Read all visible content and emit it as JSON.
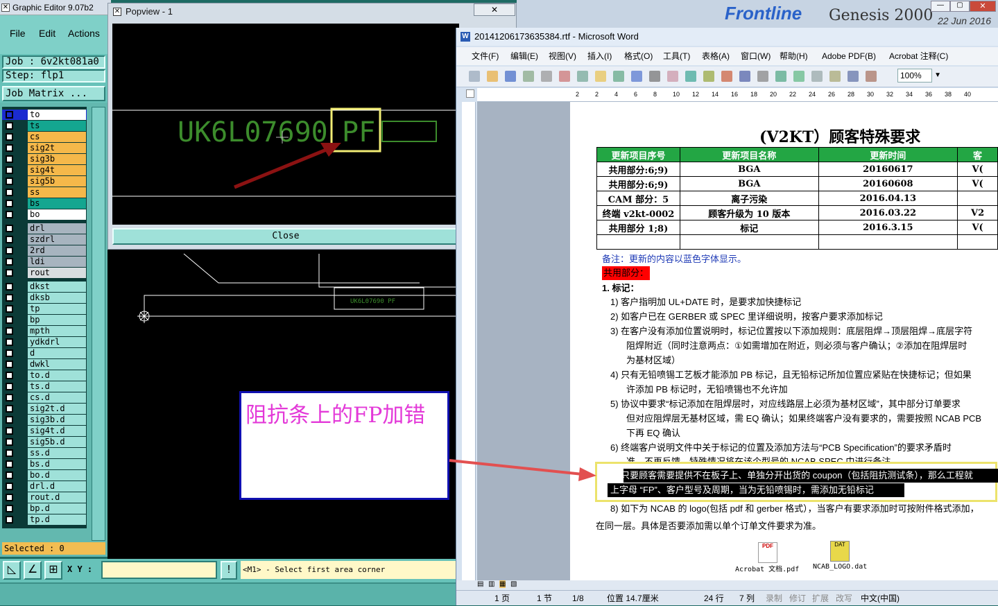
{
  "graphic_editor": {
    "title": "Graphic Editor 9.07b2",
    "menu": [
      "File",
      "Edit",
      "Actions"
    ],
    "job": "Job : 6v2kt081a0",
    "step": "Step: flp1",
    "job_matrix": "Job Matrix ...",
    "layers": [
      {
        "name": "to",
        "color": "#ffffff"
      },
      {
        "name": "ts",
        "color": "#14a690"
      },
      {
        "name": "cs",
        "color": "#f5b84a"
      },
      {
        "name": "sig2t",
        "color": "#f5b84a"
      },
      {
        "name": "sig3b",
        "color": "#f5b84a"
      },
      {
        "name": "sig4t",
        "color": "#f5b84a"
      },
      {
        "name": "sig5b",
        "color": "#f5b84a"
      },
      {
        "name": "ss",
        "color": "#f5b84a"
      },
      {
        "name": "bs",
        "color": "#14a690"
      },
      {
        "name": "bo",
        "color": "#ffffff"
      },
      {
        "name": "drl",
        "color": "#a7b4bf"
      },
      {
        "name": "szdrl",
        "color": "#a7b4bf"
      },
      {
        "name": "2rd",
        "color": "#a7b4bf"
      },
      {
        "name": "ldi",
        "color": "#a7b4bf"
      },
      {
        "name": "rout",
        "color": "#d8dde0"
      },
      {
        "name": "dkst",
        "color": "#9fe1d9"
      },
      {
        "name": "dksb",
        "color": "#9fe1d9"
      },
      {
        "name": "tp",
        "color": "#9fe1d9"
      },
      {
        "name": "bp",
        "color": "#9fe1d9"
      },
      {
        "name": "mpth",
        "color": "#9fe1d9"
      },
      {
        "name": "ydkdrl",
        "color": "#9fe1d9"
      },
      {
        "name": "d",
        "color": "#9fe1d9"
      },
      {
        "name": "dwkl",
        "color": "#9fe1d9"
      },
      {
        "name": "to.d",
        "color": "#9fe1d9"
      },
      {
        "name": "ts.d",
        "color": "#9fe1d9"
      },
      {
        "name": "cs.d",
        "color": "#9fe1d9"
      },
      {
        "name": "sig2t.d",
        "color": "#9fe1d9"
      },
      {
        "name": "sig3b.d",
        "color": "#9fe1d9"
      },
      {
        "name": "sig4t.d",
        "color": "#9fe1d9"
      },
      {
        "name": "sig5b.d",
        "color": "#9fe1d9"
      },
      {
        "name": "ss.d",
        "color": "#9fe1d9"
      },
      {
        "name": "bs.d",
        "color": "#9fe1d9"
      },
      {
        "name": "bo.d",
        "color": "#9fe1d9"
      },
      {
        "name": "drl.d",
        "color": "#9fe1d9"
      },
      {
        "name": "rout.d",
        "color": "#9fe1d9"
      },
      {
        "name": "bp.d",
        "color": "#9fe1d9"
      },
      {
        "name": "tp.d",
        "color": "#9fe1d9"
      }
    ],
    "selected": "Selected : 0",
    "xy_label": "X Y :",
    "hint": "<M1> - Select first area corner",
    "canvas_text": "UK6L07690  PF"
  },
  "popview": {
    "title": "Popview - 1",
    "canvas_text": "UK6L07690",
    "highlight_text": "PF",
    "close_label": "Close"
  },
  "annotation": {
    "text": "阻抗条上的FP加错"
  },
  "background_app": {
    "title": "Genesis 2000",
    "date": "22 Jun 2016",
    "brand": "Frontline"
  },
  "word": {
    "title": "20141206173635384.rtf - Microsoft Word",
    "menu": [
      "文件(F)",
      "编辑(E)",
      "视图(V)",
      "插入(I)",
      "格式(O)",
      "工具(T)",
      "表格(A)",
      "窗口(W)",
      "帮助(H)",
      "Adobe PDF(B)",
      "Acrobat 注释(C)"
    ],
    "zoom": "100%",
    "ruler_ticks": [
      "2",
      "2",
      "4",
      "6",
      "8",
      "10",
      "12",
      "14",
      "16",
      "18",
      "20",
      "22",
      "24",
      "26",
      "28",
      "30",
      "32",
      "34",
      "36",
      "38",
      "40"
    ],
    "doc_title": "(V2KT）顾客特殊要求",
    "table": {
      "headers": [
        "更新项目序号",
        "更新项目名称",
        "更新时间",
        "客"
      ],
      "rows": [
        [
          "共用部分:6;9)",
          "BGA",
          "20160617",
          "V("
        ],
        [
          "共用部分:6;9)",
          "BGA",
          "20160608",
          "V("
        ],
        [
          "CAM 部分：5",
          "离子污染",
          "2016.04.13",
          ""
        ],
        [
          "终端 v2kt-0002",
          "顾客升级为 10 版本",
          "2016.03.22",
          "V2"
        ],
        [
          "共用部分 1;8)",
          "标记",
          "2016.3.15",
          "V("
        ],
        [
          "",
          "",
          "",
          ""
        ]
      ]
    },
    "note": "备注：更新的内容以蓝色字体显示。",
    "section_shared": "共用部分：",
    "section_1": "1.    标记：",
    "items": [
      "1)    客户指明加 UL+DATE 时，是要求加快捷标记",
      "2)    如客户已在 GERBER 或 SPEC 里详细说明，按客户要求添加标记",
      "3)    在客户没有添加位置说明时，标记位置按以下添加规则：底层阻焊→顶层阻焊→底层字符",
      "阻焊附近（同时注意两点：①如需增加在附近，则必须与客户确认；②添加在阻焊层时",
      "为基材区域）",
      "4)    只有无铅喷锡工艺板才能添加 PB 标记，且无铅标记所加位置应紧贴在快捷标记；但如果",
      "许添加 PB 标记时，无铅喷锡也不允许加",
      "5)    协议中要求“标记添加在阻焊层时，对应线路层上必须为基材区域”，其中部分订单要求",
      "但对应阻焊层无基材区域，需 EQ 确认；如果终端客户没有要求的，需要按照 NCAB PCB",
      "下再 EQ 确认",
      "6)    终端客户说明文件中关于标记的位置及添加方法与“PCB Specification”的要求矛盾时",
      "准，不再反馈，特殊情况将在该个型号的 NCAB SPEC 中进行备注"
    ],
    "item7_line1": "7)  只要顾客需要提供不在板子上、单独分开出货的 coupon（包括阻抗测试条），那么工程就",
    "item7_line2": "上字母 “FP”、客户型号及周期，当为无铅喷锡时，需添加无铅标记",
    "item8_line1": "8)   如下为 NCAB 的 logo(包括 pdf 和 gerber 格式），当客户有要求添加时可按附件格式添加，",
    "item8_line2": "在同一层。具体是否要添加需以单个订单文件要求为准。",
    "attachments": [
      {
        "label": "Acrobat 文档.pdf",
        "icon": "pdf-file-icon"
      },
      {
        "label": "NCAB_LOGO.dat",
        "icon": "dat-file-icon"
      }
    ],
    "status": {
      "page": "1 页",
      "section": "1 节",
      "pages": "1/8",
      "position": "位置 14.7厘米",
      "line": "24 行",
      "column": "7 列",
      "rec": "录制",
      "trk": "修订",
      "ext": "扩展",
      "ovr": "改写",
      "lang": "中文(中国)"
    }
  }
}
